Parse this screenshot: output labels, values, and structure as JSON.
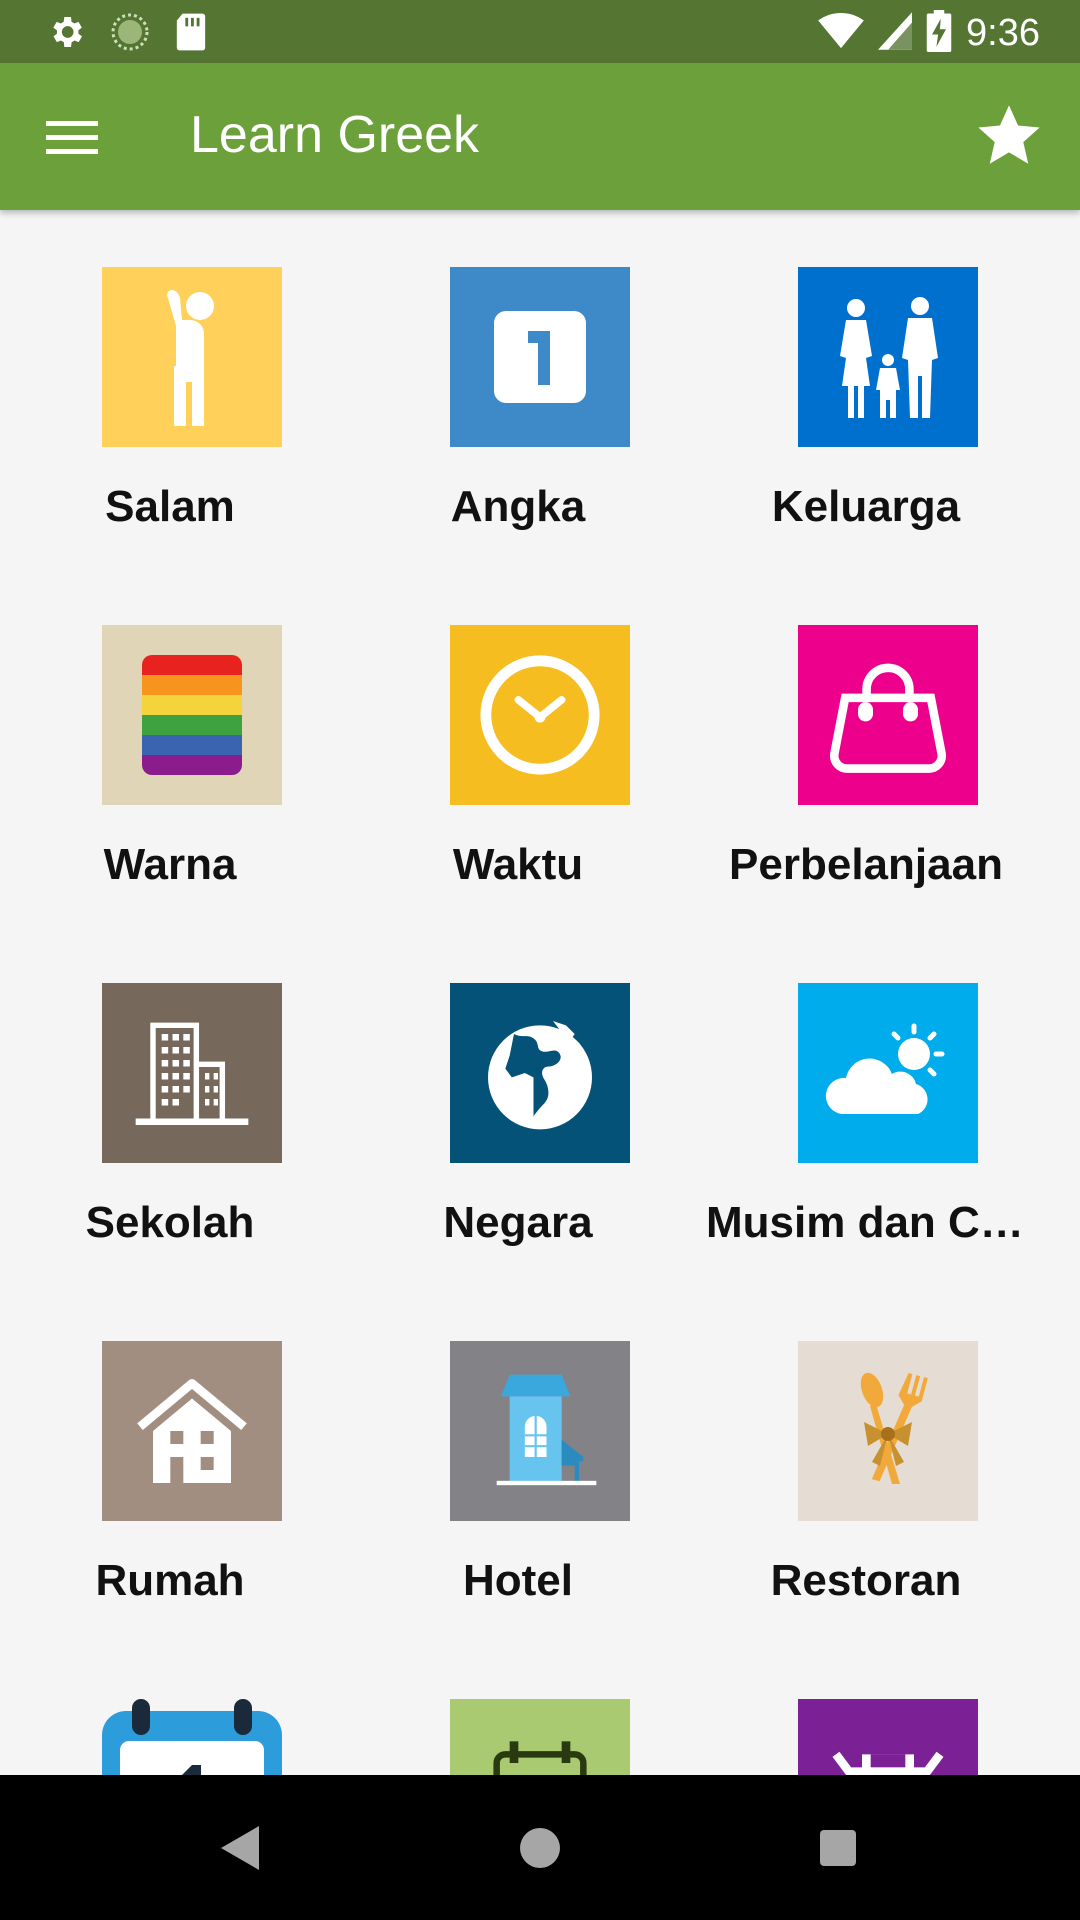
{
  "status_bar": {
    "time": "9:36",
    "icons": [
      "gear-icon",
      "loading-icon",
      "sd-card-icon",
      "wifi-icon",
      "signal-icon",
      "battery-charging-icon"
    ]
  },
  "app_bar": {
    "title": "Learn Greek",
    "menu_icon": "hamburger-menu-icon",
    "favorite_icon": "star-icon"
  },
  "categories": [
    {
      "label": "Salam",
      "icon": "person-waving-icon",
      "color": "#ffd05a"
    },
    {
      "label": "Angka",
      "icon": "number-one-icon",
      "color": "#3e89c8"
    },
    {
      "label": "Keluarga",
      "icon": "family-icon",
      "color": "#0070cf"
    },
    {
      "label": "Warna",
      "icon": "rainbow-icon",
      "color": "#e0d5b6"
    },
    {
      "label": "Waktu",
      "icon": "clock-icon",
      "color": "#f5bd20"
    },
    {
      "label": "Perbelanjaan",
      "icon": "shopping-bag-icon",
      "color": "#ec008c"
    },
    {
      "label": "Sekolah",
      "icon": "buildings-icon",
      "color": "#76695c"
    },
    {
      "label": "Negara",
      "icon": "globe-icon",
      "color": "#045277"
    },
    {
      "label": "Musim dan Cu…",
      "icon": "weather-icon",
      "color": "#00acec"
    },
    {
      "label": "Rumah",
      "icon": "house-icon",
      "color": "#a18e80"
    },
    {
      "label": "Hotel",
      "icon": "hotel-icon",
      "color": "#838387"
    },
    {
      "label": "Restoran",
      "icon": "cutlery-icon",
      "color": "#e5ddd3"
    },
    {
      "label": "",
      "icon": "calendar-icon",
      "color": "#2d9cdb"
    },
    {
      "label": "",
      "icon": "transport-icon",
      "color": "#a9ca70"
    },
    {
      "label": "",
      "icon": "shop-icon",
      "color": "#7b2095"
    }
  ],
  "nav_bar": {
    "icons": [
      "back-icon",
      "home-icon",
      "recents-icon"
    ]
  }
}
